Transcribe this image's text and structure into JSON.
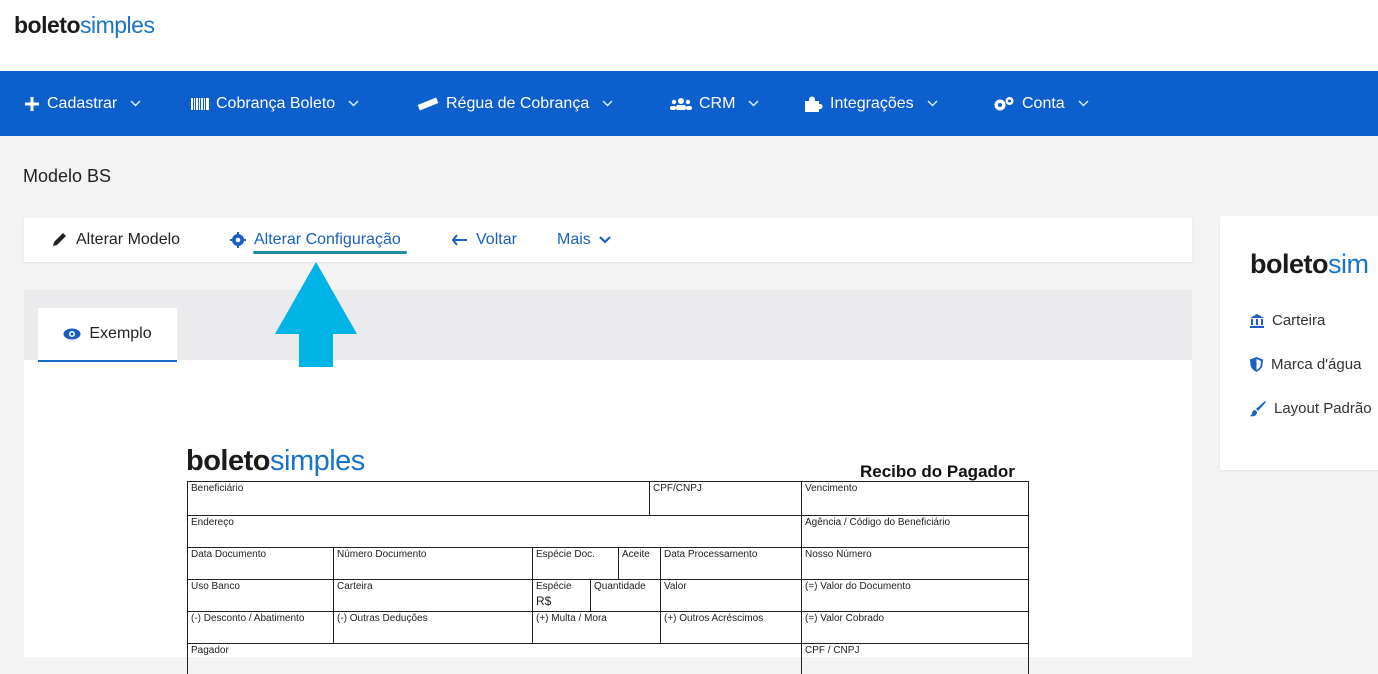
{
  "brand": {
    "bold": "boleto",
    "light": "simples"
  },
  "nav": {
    "items": [
      {
        "label": "Cadastrar",
        "icon": "plus-icon"
      },
      {
        "label": "Cobrança Boleto",
        "icon": "barcode-icon"
      },
      {
        "label": "Régua de Cobrança",
        "icon": "ruler-icon"
      },
      {
        "label": "CRM",
        "icon": "users-icon"
      },
      {
        "label": "Integrações",
        "icon": "puzzle-icon"
      },
      {
        "label": "Conta",
        "icon": "gears-icon"
      }
    ]
  },
  "page": {
    "title": "Modelo BS"
  },
  "toolbar": {
    "alterar_modelo": "Alterar Modelo",
    "alterar_configuracao": "Alterar Configuração",
    "voltar": "Voltar",
    "mais": "Mais"
  },
  "tabs": {
    "exemplo": "Exemplo"
  },
  "boleto": {
    "title": "Recibo do Pagador",
    "row1": {
      "beneficiario": "Beneficiário",
      "cpf_cnpj": "CPF/CNPJ",
      "vencimento": "Vencimento"
    },
    "row2": {
      "endereco": "Endereço",
      "agencia": "Agência / Código do Beneficiário"
    },
    "row3": {
      "data_documento": "Data Documento",
      "numero_documento": "Número Documento",
      "especie_doc": "Espécie Doc.",
      "aceite": "Aceite",
      "data_processamento": "Data Processamento",
      "nosso_numero": "Nosso Número"
    },
    "row4": {
      "uso_banco": "Uso Banco",
      "carteira": "Carteira",
      "especie": "Espécie",
      "especie_value": "R$",
      "quantidade": "Quantidade",
      "valor": "Valor",
      "valor_documento": "(=) Valor do Documento"
    },
    "row5": {
      "desconto": "(-) Desconto / Abatimento",
      "outras_deducoes": "(-) Outras Deduções",
      "multa": "(+) Multa / Mora",
      "outros_acrescimos": "(+) Outros Acréscimos",
      "valor_cobrado": "(=) Valor Cobrado"
    },
    "row6": {
      "pagador": "Pagador",
      "cpf_cnpj": "CPF / CNPJ"
    }
  },
  "sidebar": {
    "logo_bold": "boleto",
    "logo_light": "sim",
    "items": [
      {
        "label": "Carteira",
        "icon": "bank-icon"
      },
      {
        "label": "Marca d'água",
        "icon": "shield-icon"
      },
      {
        "label": "Layout Padrão",
        "icon": "paintbrush-icon"
      }
    ]
  },
  "colors": {
    "nav_bg": "#0c5fcc",
    "accent": "#1a5fc4",
    "arrow": "#00b4e6",
    "underline": "#1f8ca8"
  }
}
